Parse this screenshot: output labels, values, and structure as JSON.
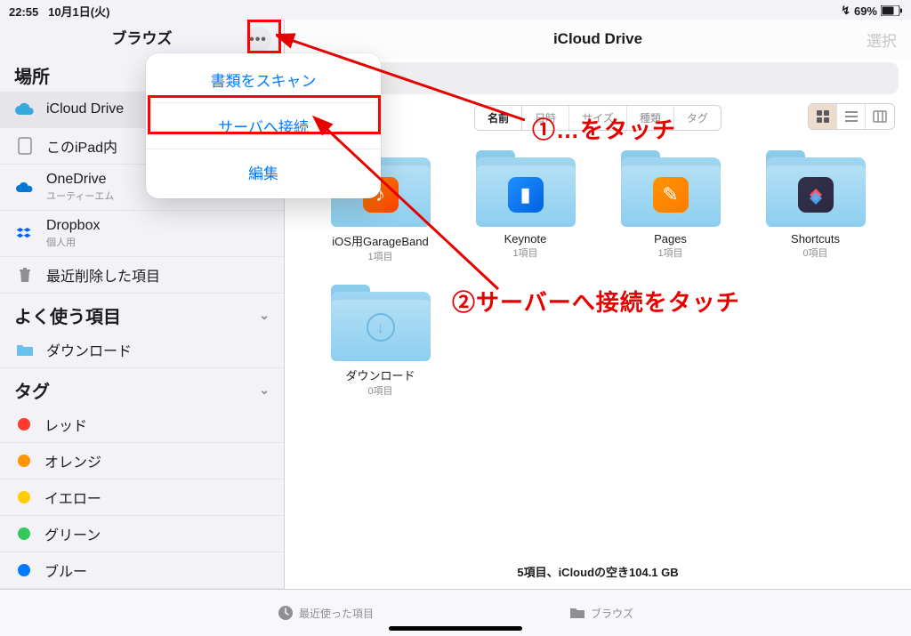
{
  "statusbar": {
    "time": "22:55",
    "date": "10月1日(火)",
    "battery": "69%",
    "recharge_icon": "↯"
  },
  "sidebar": {
    "title": "ブラウズ",
    "sections": {
      "locations_title": "場所",
      "locations": [
        {
          "name": "iCloud Drive",
          "subtext": "",
          "icon": "cloud",
          "selected": true
        },
        {
          "name": "このiPad内",
          "subtext": "",
          "icon": "ipad"
        },
        {
          "name": "OneDrive",
          "subtext": "ユーティーエム",
          "icon": "onedrive"
        },
        {
          "name": "Dropbox",
          "subtext": "個人用",
          "icon": "dropbox"
        },
        {
          "name": "最近削除した項目",
          "subtext": "",
          "icon": "trash"
        }
      ],
      "favorites_title": "よく使う項目",
      "favorites": [
        {
          "name": "ダウンロード",
          "icon": "folder"
        }
      ],
      "tags_title": "タグ",
      "tags": [
        {
          "name": "レッド",
          "color": "#ff3b30"
        },
        {
          "name": "オレンジ",
          "color": "#ff9500"
        },
        {
          "name": "イエロー",
          "color": "#ffcc00"
        },
        {
          "name": "グリーン",
          "color": "#34c759"
        },
        {
          "name": "ブルー",
          "color": "#007aff"
        }
      ]
    }
  },
  "popover": {
    "scan": "書類をスキャン",
    "connect": "サーバへ接続",
    "edit": "編集"
  },
  "content": {
    "title": "iCloud Drive",
    "select": "選択",
    "sort_segments": [
      "名前",
      "日時",
      "サイズ",
      "種類",
      "タグ"
    ],
    "folders": [
      {
        "name": "iOS用GarageBand",
        "count": "1項目",
        "app_color": "linear-gradient(135deg,#ff8a00,#ff3d00)",
        "glyph": "♪"
      },
      {
        "name": "Keynote",
        "count": "1項目",
        "app_color": "linear-gradient(135deg,#1e90ff,#0060df)",
        "glyph": "▮"
      },
      {
        "name": "Pages",
        "count": "1項目",
        "app_color": "linear-gradient(135deg,#ff9500,#ff7a00)",
        "glyph": "✎"
      },
      {
        "name": "Shortcuts",
        "count": "0項目",
        "app_color": "linear-gradient(135deg,#34314c,#2b2940)",
        "glyph": "◆"
      },
      {
        "name": "ダウンロード",
        "count": "0項目",
        "app_color": "",
        "glyph": "↓",
        "download": true
      }
    ],
    "status": "5項目、iCloudの空き104.1 GB"
  },
  "tabbar": {
    "recent": "最近使った項目",
    "browse": "ブラウズ"
  },
  "annotations": {
    "step1": "①…をタッチ",
    "step2": "②サーバーへ接続をタッチ"
  }
}
